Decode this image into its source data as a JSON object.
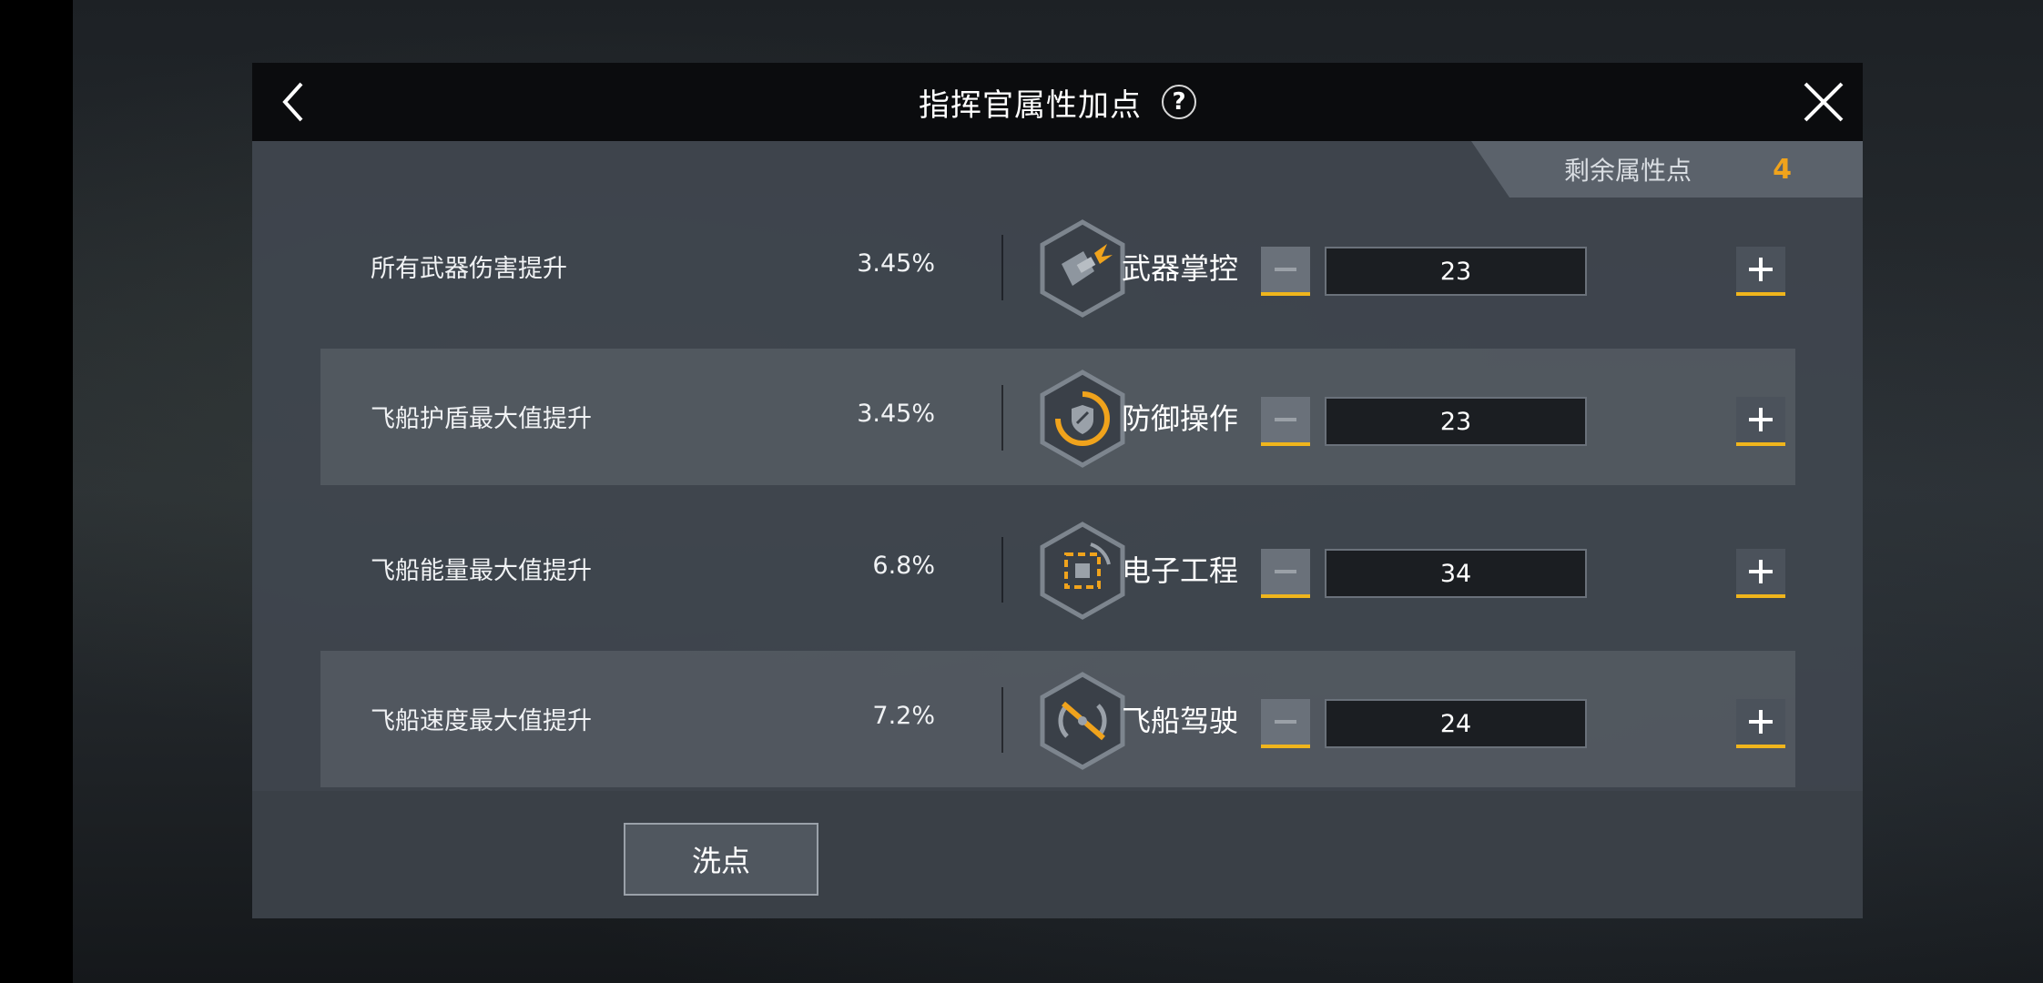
{
  "header": {
    "title": "指挥官属性加点",
    "help_symbol": "?"
  },
  "points": {
    "label": "剩余属性点",
    "value": "4"
  },
  "rows": [
    {
      "stat": "所有武器伤害提升",
      "value": "3.45%",
      "attribute": "武器掌控",
      "points": "23",
      "icon": "weapon-mastery-icon"
    },
    {
      "stat": "飞船护盾最大值提升",
      "value": "3.45%",
      "attribute": "防御操作",
      "points": "23",
      "icon": "shield-operation-icon"
    },
    {
      "stat": "飞船能量最大值提升",
      "value": "6.8%",
      "attribute": "电子工程",
      "points": "34",
      "icon": "electronics-icon"
    },
    {
      "stat": "飞船速度最大值提升",
      "value": "7.2%",
      "attribute": "飞船驾驶",
      "points": "24",
      "icon": "piloting-icon"
    }
  ],
  "footer": {
    "reset_label": "洗点"
  },
  "colors": {
    "accent": "#f0a31c",
    "button_underline": "#f0b51c",
    "header_bg": "#0b0c0e",
    "panel_bg": "#40464e"
  }
}
